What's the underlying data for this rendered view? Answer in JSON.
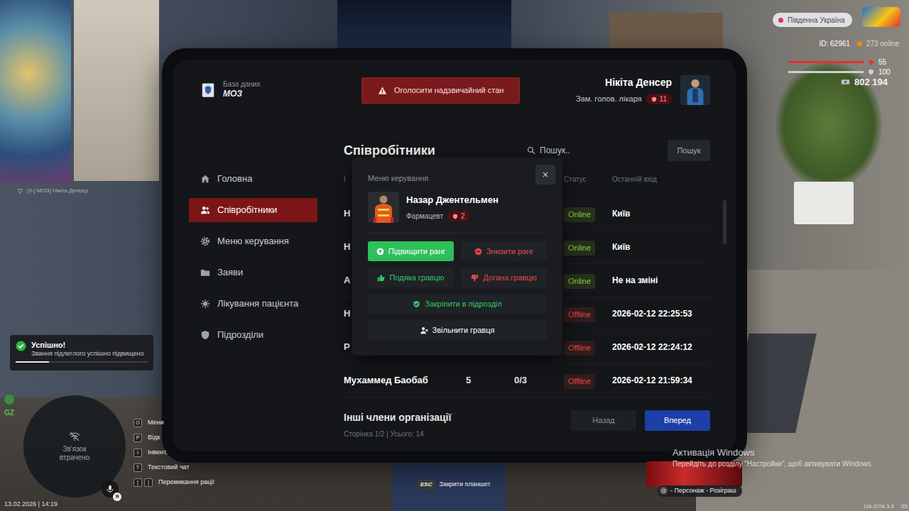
{
  "scene": {
    "nametag": "[3-] МОЗ] Нікіта Денсер"
  },
  "hud": {
    "server": "Південна Україна",
    "player_id": "ID: 62961",
    "online": "273 online",
    "health": {
      "value": "55",
      "level": 1
    },
    "armor": {
      "value": "100",
      "level": 1
    },
    "money": "802 194",
    "zone": "GZ",
    "minimap": {
      "status": "Зв'язок втрачено"
    },
    "voice": {
      "badge": "Я"
    },
    "hints": [
      {
        "keys": [
          "O"
        ],
        "label": "Мени"
      },
      {
        "keys": [
          "P"
        ],
        "label": "Відк"
      },
      {
        "keys": [
          "I"
        ],
        "label": "Інвент."
      },
      {
        "keys": [
          "T"
        ],
        "label": "Текстовий чат"
      },
      {
        "keys": [
          "[",
          "]"
        ],
        "label": "Перемикання рації"
      }
    ],
    "datetime": "13.02.2026 | 14:19",
    "close_hint": {
      "key": "ESC",
      "label": "Закрити планшет"
    },
    "giveaway": {
      "key": "O",
      "label": "- Персонаж - Розіграш"
    },
    "version": "UA-GTA 3.6",
    "fps": "55"
  },
  "notification": {
    "title": "Успішно!",
    "message": "Звання підлеглого успішно підвищено",
    "level": 0.25
  },
  "watermark": {
    "title": "Активація Windows",
    "text": "Перейдіть до розділу \"Настройки\", щоб активувати Windows."
  },
  "tablet": {
    "logo": {
      "subtitle": "База даних",
      "title": "МОЗ"
    },
    "emergency_button": "Оголосити надзвичайний стан",
    "user": {
      "name": "Нікіта Денсер",
      "role": "Зам. голов. лікаря",
      "rank": "11"
    },
    "sidebar": {
      "items": [
        {
          "label": "Головна",
          "selected": false
        },
        {
          "label": "Співробітники",
          "selected": true
        },
        {
          "label": "Меню керування",
          "selected": false
        },
        {
          "label": "Заяви",
          "selected": false
        },
        {
          "label": "Лікування пацієнта",
          "selected": false
        },
        {
          "label": "Підрозділи",
          "selected": false
        }
      ]
    },
    "page_title": "Співробітники",
    "search": {
      "placeholder": "Пошук..",
      "button": "Пошук"
    },
    "table": {
      "columns": {
        "name": "І",
        "status": "Статус",
        "last_login": "Останній вхід"
      },
      "rows": [
        {
          "name": "Н",
          "status": "Online",
          "color": "#8cc63f",
          "last_login": "Київ"
        },
        {
          "name": "Н",
          "status": "Online",
          "color": "#8cc63f",
          "last_login": "Київ"
        },
        {
          "name": "А",
          "status": "Online",
          "color": "#8cc63f",
          "last_login": "Не на зміні"
        },
        {
          "name": "Н",
          "status": "Offline",
          "color": "#e0483e",
          "last_login": "2026-02-12 22:25:53"
        },
        {
          "name": "Р",
          "status": "Offline",
          "color": "#e0483e",
          "last_login": "2026-02-12 22:24:12"
        },
        {
          "name": "Мухаммед Баобаб",
          "rank": "5",
          "warnings": "0/3",
          "status": "Offline",
          "color": "#e0483e",
          "last_login": "2026-02-12 21:59:34"
        }
      ]
    },
    "section_title": "Інші члени організації",
    "page_info": "Сторінка 1/2 | Усього: 14",
    "pagination": [
      {
        "label": "Назад",
        "disabled": true
      },
      {
        "label": "Вперед",
        "disabled": false
      }
    ],
    "modal": {
      "label": "Меню керування",
      "member": {
        "name": "Назар Джентельмен",
        "role": "Фармацевт",
        "rank": "2"
      },
      "actions": [
        {
          "label": "Підвищити ранг",
          "kind": "promote",
          "color": "#2fbf5a",
          "hovered": true
        },
        {
          "label": "Знизити ранг",
          "kind": "demote",
          "color": "#e04848",
          "hovered": false
        },
        {
          "label": "Подяка гравцю",
          "kind": "thanks",
          "color": "#35c46a",
          "hovered": false
        },
        {
          "label": "Догана гравцю",
          "kind": "reprimand",
          "color": "#e04848",
          "hovered": false
        }
      ],
      "wide_actions": [
        {
          "label": "Закріпити в підрозділ",
          "kind": "assign",
          "color": "#35c46a",
          "hovered": false
        },
        {
          "label": "Звільнити гравця",
          "kind": "fire",
          "color": "#ffffff",
          "hovered": false
        }
      ]
    }
  }
}
